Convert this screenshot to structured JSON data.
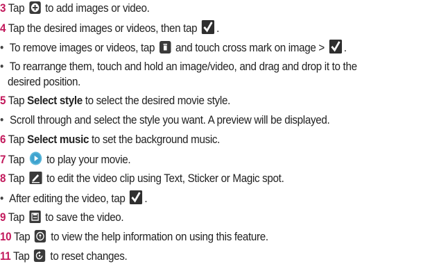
{
  "steps": [
    {
      "num": "3",
      "a": "Tap",
      "b": "to add images or video.",
      "icon": "add-circle-icon"
    },
    {
      "num": "4",
      "a": "Tap the desired images or videos, then tap",
      "b": ".",
      "icon": "checkmark-icon"
    },
    {
      "bullet": "To remove images or videos, tap",
      "mid": "and touch cross mark on image >",
      "end": ".",
      "icon1": "trash-icon",
      "icon2": "checkmark-icon"
    },
    {
      "bullet": "To rearrange them, touch and hold an image/video, and drag and drop it to the"
    },
    {
      "cont": "desired position."
    },
    {
      "num": "5",
      "a": "Tap",
      "bold": "Select style",
      "b": "to select the desired movie style."
    },
    {
      "bullet": "Scroll through and select the style you want. A preview will be displayed."
    },
    {
      "num": "6",
      "a": "Tap",
      "bold": "Select music",
      "b": "to set the background music."
    },
    {
      "num": "7",
      "a": "Tap",
      "b": "to play your movie.",
      "icon": "play-icon"
    },
    {
      "num": "8",
      "a": "Tap",
      "b": "to edit the video clip using Text, Sticker or Magic spot.",
      "icon": "edit-icon"
    },
    {
      "bullet": "After editing the video, tap",
      "end": ".",
      "icon": "checkmark-icon"
    },
    {
      "num": "9",
      "a": "Tap",
      "b": "to save the video.",
      "icon": "save-icon"
    },
    {
      "num": "10",
      "a": "Tap",
      "b": "to view the help information on using this feature.",
      "icon": "help-icon"
    },
    {
      "num": "11",
      "a": "Tap",
      "b": "to reset changes.",
      "icon": "reset-icon"
    }
  ],
  "colors": {
    "step_number": "#c2185b",
    "icon_bg": "#3a3a3a",
    "checkmark_bg": "#2f2f2f"
  }
}
